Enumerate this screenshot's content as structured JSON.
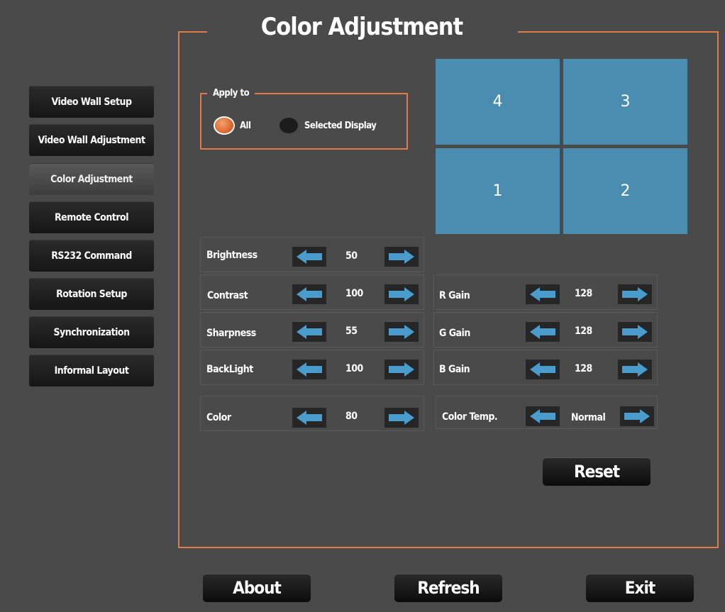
{
  "title": "Color Adjustment",
  "nav": [
    {
      "label": "Video Wall Setup",
      "active": false
    },
    {
      "label": "Video Wall Adjustment",
      "active": false
    },
    {
      "label": "Color Adjustment",
      "active": true
    },
    {
      "label": "Remote Control",
      "active": false
    },
    {
      "label": "RS232 Command",
      "active": false
    },
    {
      "label": "Rotation Setup",
      "active": false
    },
    {
      "label": "Synchronization",
      "active": false
    },
    {
      "label": "Informal Layout",
      "active": false
    }
  ],
  "apply_to": {
    "legend": "Apply to",
    "options": [
      {
        "label": "All",
        "selected": true
      },
      {
        "label": "Selected Display",
        "selected": false
      }
    ]
  },
  "display_grid": {
    "tiles": [
      "4",
      "3",
      "1",
      "2"
    ],
    "color": "#4a8db0"
  },
  "settings_left": [
    {
      "label": "Brightness",
      "value": "50"
    },
    {
      "label": "Contrast",
      "value": "100"
    },
    {
      "label": "Sharpness",
      "value": "55"
    },
    {
      "label": "BackLight",
      "value": "100"
    },
    {
      "label": "Color",
      "value": "80"
    }
  ],
  "settings_right": [
    {
      "label": "R Gain",
      "value": "128"
    },
    {
      "label": "G Gain",
      "value": "128"
    },
    {
      "label": "B Gain",
      "value": "128"
    },
    {
      "label": "Color Temp.",
      "value": "Normal"
    }
  ],
  "buttons": {
    "reset": "Reset",
    "about": "About",
    "refresh": "Refresh",
    "exit": "Exit"
  },
  "colors": {
    "accent": "#e07a48",
    "arrow": "#4a9ccc",
    "background": "#4a4a4a"
  }
}
